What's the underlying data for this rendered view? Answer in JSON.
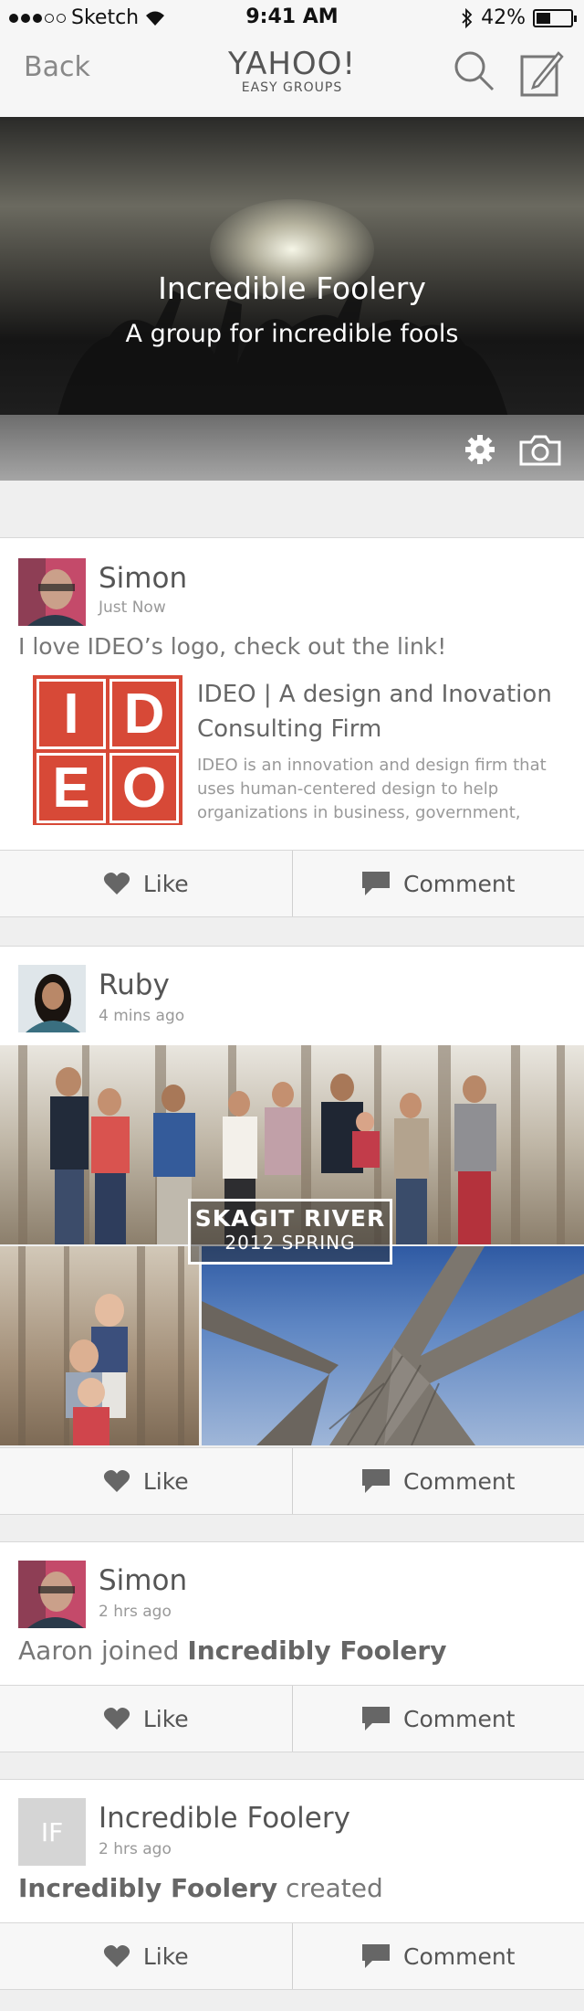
{
  "status_bar": {
    "carrier": "Sketch",
    "time": "9:41 AM",
    "battery": "42%",
    "battery_level": 0.42
  },
  "nav": {
    "back_label": "Back",
    "brand_title": "YAHOO!",
    "brand_subtitle": "EASY GROUPS",
    "icons": [
      "search-icon",
      "compose-icon"
    ]
  },
  "group": {
    "name": "Incredible Foolery",
    "tagline": "A group for incredible fools"
  },
  "posts": [
    {
      "author": "Simon",
      "time": "Just Now",
      "text": "I love IDEO’s logo, check out the link!",
      "link": {
        "logo_letters": [
          "I",
          "D",
          "E",
          "O"
        ],
        "title": "IDEO | A design and Inovation Consulting Firm",
        "description": "IDEO is an innovation and design firm that uses human-centered design to help organizations in business, government,"
      },
      "like_label": "Like",
      "comment_label": "Comment"
    },
    {
      "author": "Ruby",
      "time": "4 mins ago",
      "album": {
        "title": "SKAGIT RIVER",
        "subtitle": "2012 SPRING"
      },
      "like_label": "Like",
      "comment_label": "Comment"
    },
    {
      "author": "Simon",
      "time": "2 hrs ago",
      "text_prefix": "Aaron joined ",
      "text_bold": "Incredibly Foolery",
      "like_label": "Like",
      "comment_label": "Comment"
    },
    {
      "author": "Incredible Foolery",
      "avatar_initials": "IF",
      "time": "2 hrs ago",
      "text_bold": "Incredibly Foolery",
      "text_suffix": " created",
      "like_label": "Like",
      "comment_label": "Comment"
    }
  ],
  "colors": {
    "ideo_red": "#d74937",
    "background": "#efefef"
  }
}
